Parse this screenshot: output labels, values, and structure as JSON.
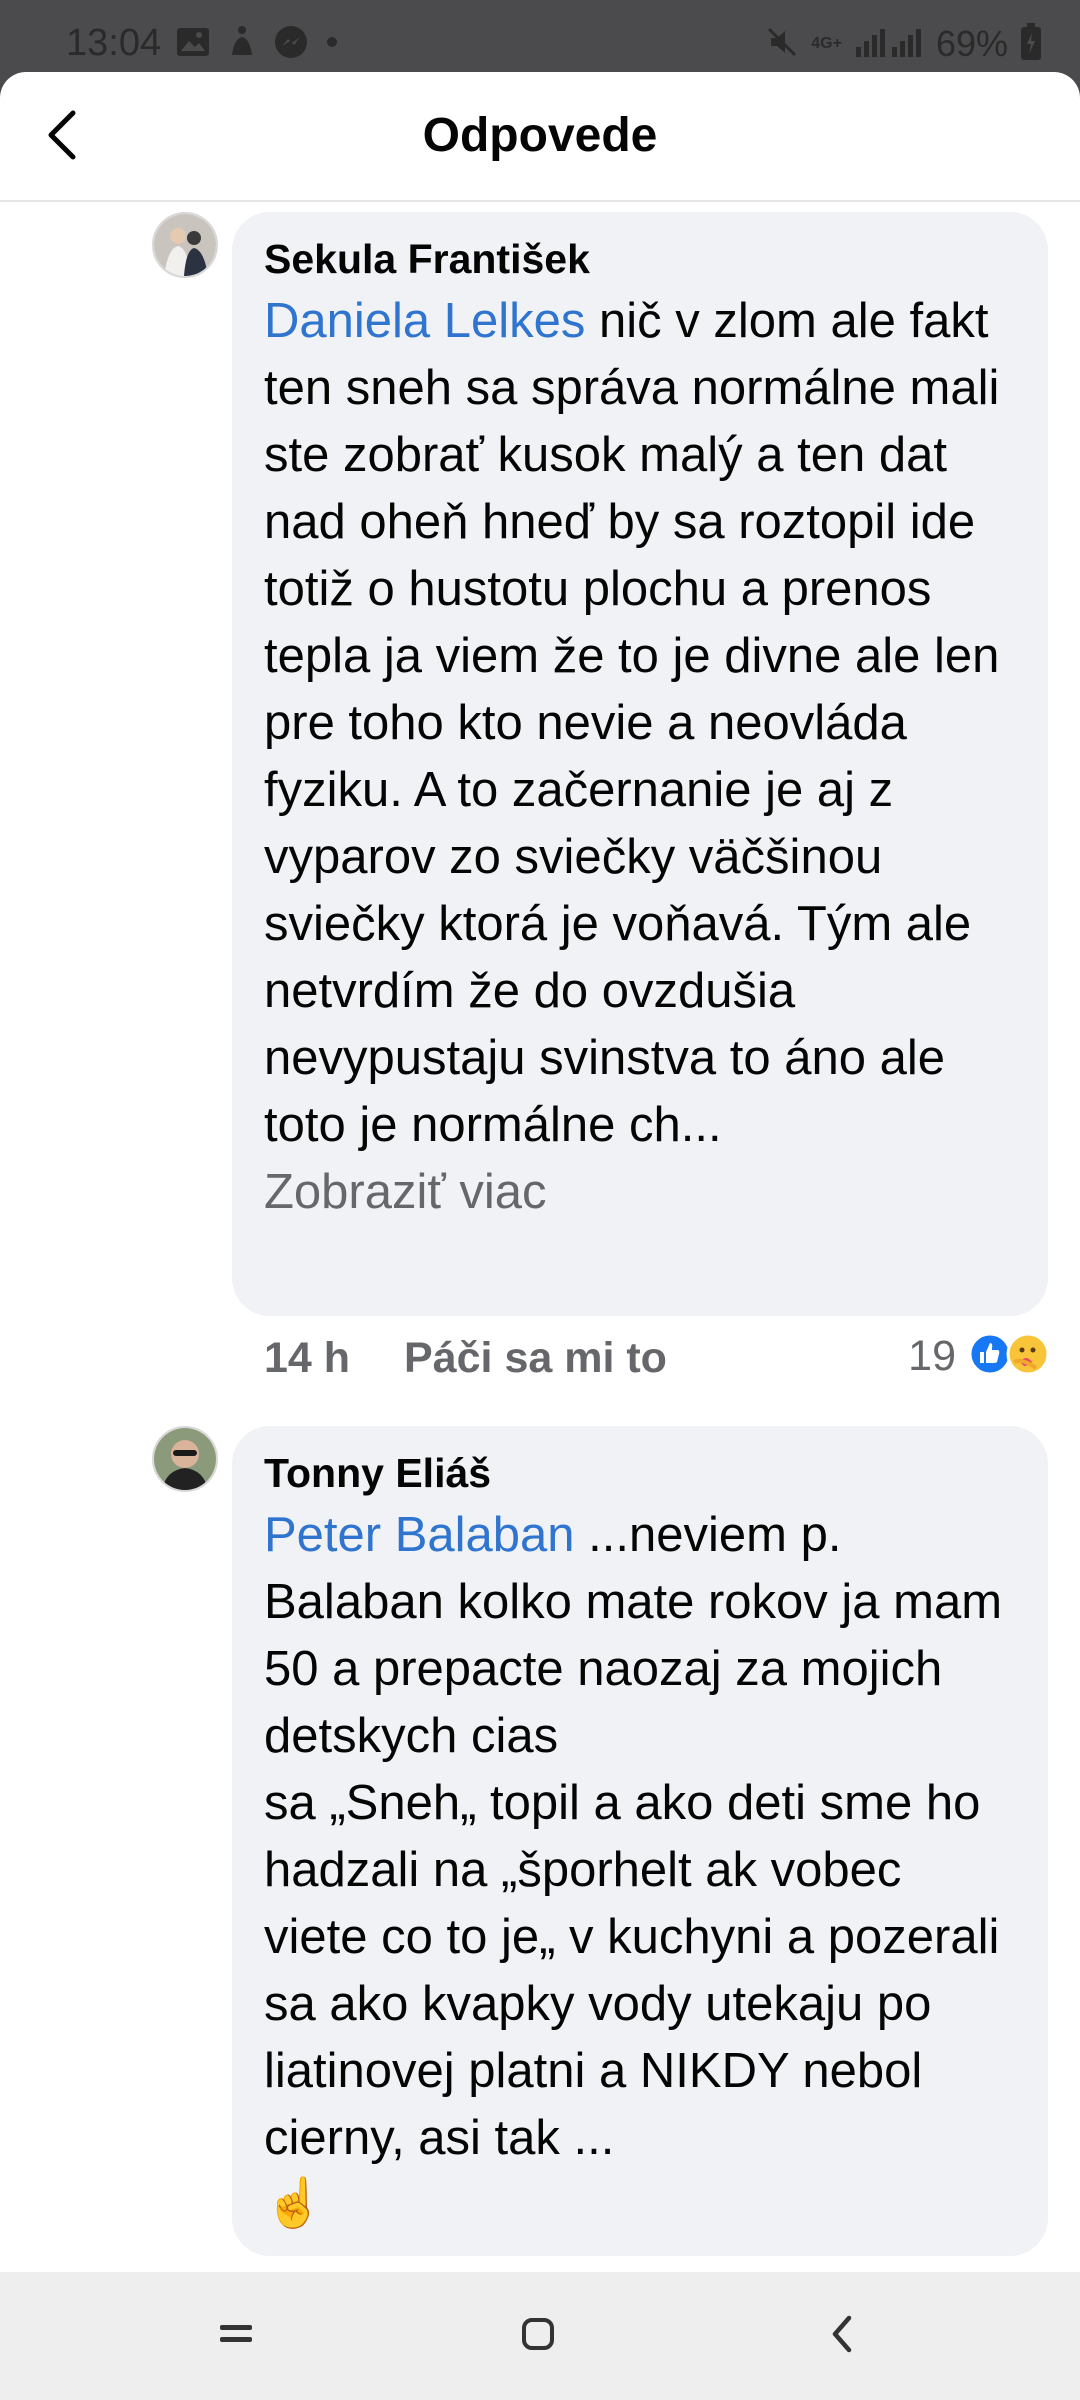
{
  "status_bar": {
    "time": "13:04",
    "battery": "69%",
    "network": "4G+",
    "icons": [
      "image-icon",
      "accessibility-icon",
      "messenger-icon",
      "dot-icon",
      "mute-icon",
      "signal-icon",
      "battery-icon"
    ]
  },
  "header": {
    "title": "Odpovede",
    "back_icon": "back-arrow-icon"
  },
  "comments": [
    {
      "author": "Sekula František",
      "mention": "Daniela Lelkes",
      "text": " nič v zlom ale fakt ten sneh sa správa normálne mali ste zobrať kusok malý a ten dat nad oheň hneď by sa roztopil ide totiž o hustotu plochu a prenos tepla ja viem že to je divne ale len pre toho kto nevie a neovláda fyziku. A to začernanie je aj z vyparov zo sviečky väčšinou sviečky ktorá je voňavá. Tým ale netvrdím že do ovzdušia nevypustaju svinstva to áno ale toto je normálne ch...",
      "see_more": "Zobraziť viac",
      "time": "14 h",
      "like_label": "Páči sa mi to",
      "reaction_count": "19",
      "reactions": [
        "like-reaction-icon",
        "care-reaction-icon"
      ]
    },
    {
      "author": "Tonny Eliáš",
      "mention": "Peter Balaban",
      "text": " ...neviem p. Balaban kolko mate rokov ja mam 50 a prepacte naozaj za mojich detskych cias\nsa „Sneh„ topil a ako deti sme ho hadzali na „šporhelt ak vobec viete co to je„ v kuchyni a pozerali sa ako kvapky vody utekaju po liatinovej platni a NIKDY nebol cierny, asi tak ...",
      "emoji": "☝️"
    }
  ],
  "nav_bar": {
    "icons": [
      "recent-apps-icon",
      "home-icon",
      "back-icon"
    ]
  },
  "colors": {
    "mention": "#2f74cf",
    "bubble": "#f0f2f5",
    "meta": "#65676b",
    "like_reaction": "#1877f2"
  }
}
